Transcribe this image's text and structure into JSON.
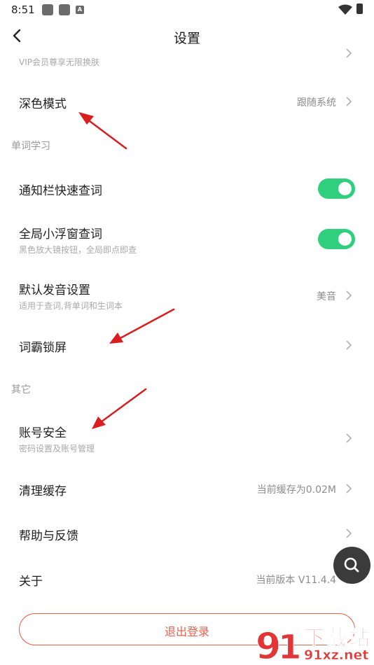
{
  "status_bar": {
    "time": "8:51",
    "notif_letter": "A"
  },
  "nav": {
    "title": "设置"
  },
  "vip": {
    "subtitle": "VIP会员尊享无限换肤"
  },
  "dark_mode": {
    "title": "深色模式",
    "value": "跟随系统"
  },
  "section_word": {
    "title": "单词学习"
  },
  "notify_lookup": {
    "title": "通知栏快速查词",
    "enabled": true
  },
  "float_lookup": {
    "title": "全局小浮窗查词",
    "subtitle": "黑色放大镜按钮，全局即点即查",
    "enabled": true
  },
  "pronunciation": {
    "title": "默认发音设置",
    "subtitle": "适用于查词,背单词和生词本",
    "value": "美音"
  },
  "lock_screen": {
    "title": "词霸锁屏"
  },
  "section_other": {
    "title": "其它"
  },
  "account": {
    "title": "账号安全",
    "subtitle": "密码设置及账号管理"
  },
  "cache": {
    "title": "清理缓存",
    "value": "当前缓存为0.02M"
  },
  "help": {
    "title": "帮助与反馈"
  },
  "about": {
    "title": "关于",
    "value": "当前版本 V11.4.4"
  },
  "logout": {
    "label": "退出登录"
  },
  "watermark": {
    "text": "下载站",
    "url": "91xz.net"
  },
  "colors": {
    "accent_green": "#2fcf7e",
    "logout_red": "#e7624d",
    "annotation_red": "#d81e1e"
  }
}
